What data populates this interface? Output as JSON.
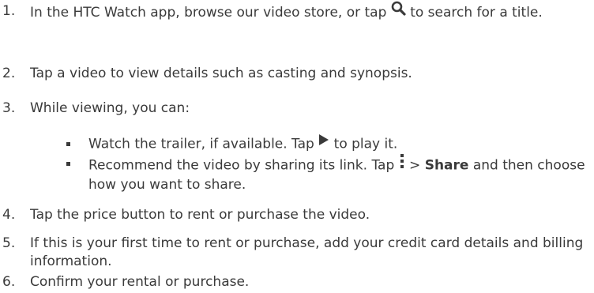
{
  "steps": [
    {
      "num": "1.",
      "text_before": "In the HTC Watch app, browse our video store, or tap ",
      "text_after": " to search for a title."
    },
    {
      "num": "2.",
      "text": "Tap a video to view details such as casting and synopsis."
    },
    {
      "num": "3.",
      "text": "While viewing, you can:"
    },
    {
      "num": "4.",
      "text": "Tap the price button to rent or purchase the video."
    },
    {
      "num": "5.",
      "text": "If this is your first time to rent or purchase, add your credit card details and billing information."
    },
    {
      "num": "6.",
      "text": "Confirm your rental or purchase."
    }
  ],
  "bullets": [
    {
      "text_before": "Watch the trailer, if available. Tap ",
      "text_after": " to play it."
    },
    {
      "text_before": "Recommend the video by sharing its link. Tap ",
      "text_mid": " > ",
      "share_label": "Share",
      "text_after": " and then choose how you want to share."
    }
  ],
  "icons": {
    "search": "search-icon",
    "play": "play-icon",
    "menu": "menu-icon"
  },
  "colors": {
    "text": "#3a3a3a"
  }
}
